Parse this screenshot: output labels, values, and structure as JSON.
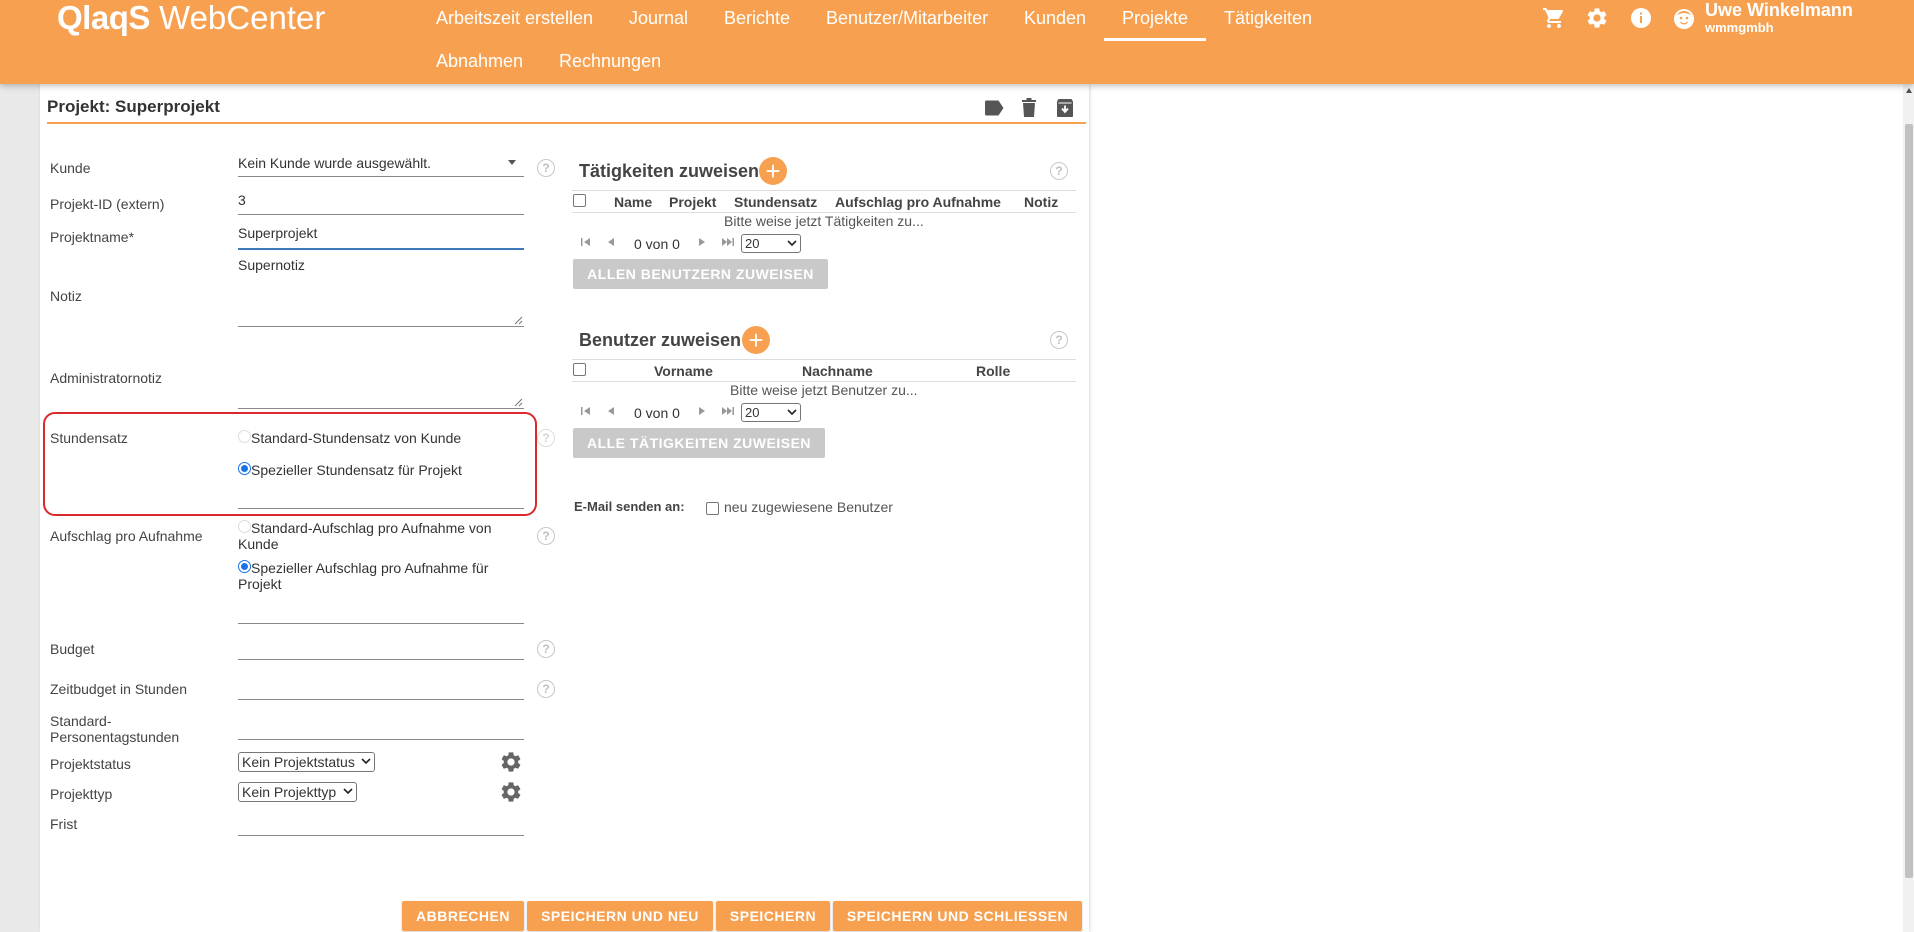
{
  "app": {
    "logo_bold": "QlaqS",
    "logo_rest": "WebCenter"
  },
  "nav": {
    "items": [
      "Arbeitszeit erstellen",
      "Journal",
      "Berichte",
      "Benutzer/Mitarbeiter",
      "Kunden",
      "Projekte",
      "Tätigkeiten",
      "Abnahmen",
      "Rechnungen"
    ],
    "active": "Projekte"
  },
  "user": {
    "name": "Uwe Winkelmann",
    "org": "wmmgmbh"
  },
  "icons": {
    "cart": "cart-icon",
    "settings": "gear-icon",
    "info": "info-icon",
    "avatar": "avatar-icon",
    "label": "tag-icon",
    "delete": "trash-icon",
    "archive": "archive-icon"
  },
  "colors": {
    "accent": "#f7a150",
    "highlight": "#d9292c",
    "radio": "#1a73e8"
  },
  "panel": {
    "title": "Projekt: Superprojekt"
  },
  "form": {
    "kunde_label": "Kunde",
    "kunde_value": "Kein Kunde wurde ausgewählt.",
    "projekt_id_label": "Projekt-ID (extern)",
    "projekt_id_value": "3",
    "projektname_label": "Projektname*",
    "projektname_value": "Superprojekt",
    "notiz_label": "Notiz",
    "notiz_value": "Supernotiz",
    "adminnotiz_label": "Administratornotiz",
    "stundensatz_label": "Stundensatz",
    "stundensatz_opt1": "Standard-Stundensatz von Kunde",
    "stundensatz_opt2": "Spezieller Stundensatz für Projekt",
    "aufschlag_label": "Aufschlag pro Aufnahme",
    "aufschlag_opt1_a": "Standard-Aufschlag pro Aufnahme von",
    "aufschlag_opt1_b": "Kunde",
    "aufschlag_opt2_a": "Spezieller Aufschlag pro Aufnahme für",
    "aufschlag_opt2_b": "Projekt",
    "budget_label": "Budget",
    "zeitbudget_label": "Zeitbudget in Stunden",
    "standard_pt_label_a": "Standard-",
    "standard_pt_label_b": "Personentagstunden",
    "projektstatus_label": "Projektstatus",
    "projektstatus_value": "Kein Projektstatus",
    "projekttyp_label": "Projekttyp",
    "projekttyp_value": "Kein Projekttyp",
    "frist_label": "Frist",
    "help_glyph": "?"
  },
  "taetigkeiten": {
    "title": "Tätigkeiten zuweisen",
    "columns": [
      "Name",
      "Projekt",
      "Stundensatz",
      "Aufschlag pro Aufnahme",
      "Notiz"
    ],
    "empty": "Bitte weise jetzt Tätigkeiten zu...",
    "pager_text": "0 von 0",
    "page_size": "20",
    "assign_button": "ALLEN BENUTZERN ZUWEISEN"
  },
  "benutzer": {
    "title": "Benutzer zuweisen",
    "columns": [
      "Vorname",
      "Nachname",
      "Rolle"
    ],
    "empty": "Bitte weise jetzt Benutzer zu...",
    "pager_text": "0 von 0",
    "page_size": "20",
    "assign_button": "ALLE TÄTIGKEITEN ZUWEISEN"
  },
  "email": {
    "label": "E-Mail senden an:",
    "option": "neu zugewiesene Benutzer"
  },
  "actions": {
    "cancel": "ABBRECHEN",
    "save_new": "SPEICHERN UND NEU",
    "save": "SPEICHERN",
    "save_close": "SPEICHERN UND SCHLIESSEN"
  }
}
